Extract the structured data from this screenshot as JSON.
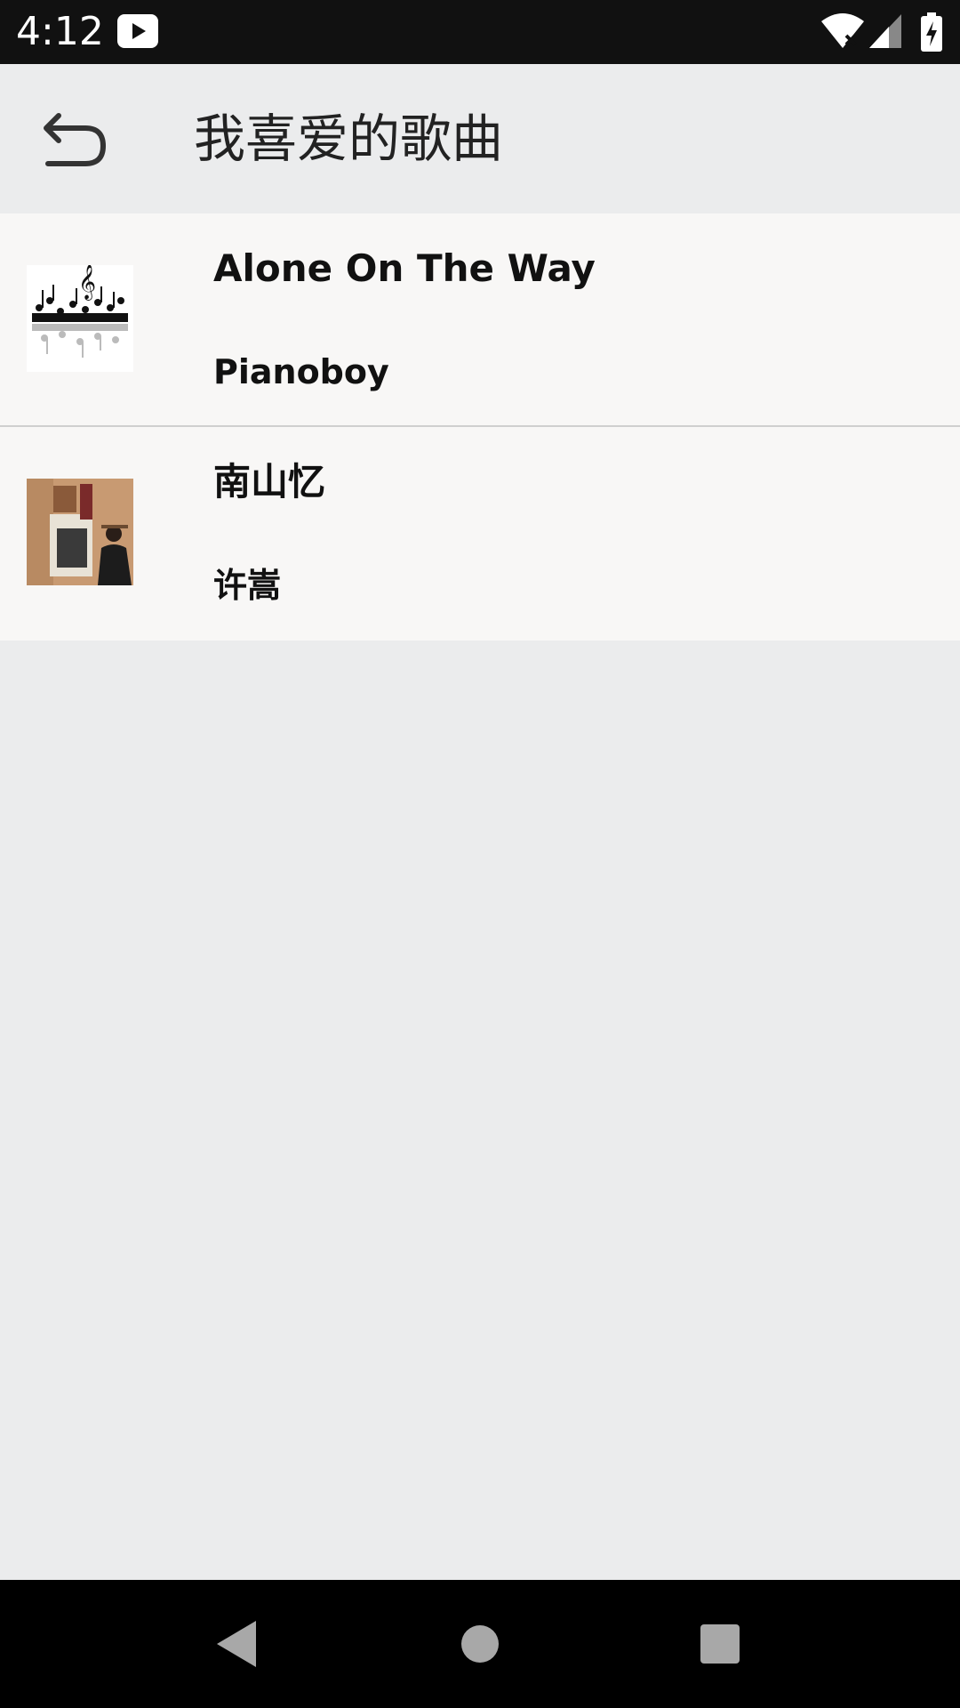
{
  "status_bar": {
    "time": "4:12",
    "icons": [
      "youtube-icon",
      "wifi-icon",
      "signal-icon",
      "battery-charging-icon"
    ]
  },
  "app_bar": {
    "title": "我喜爱的歌曲",
    "back_icon": "undo-arrow-icon"
  },
  "songs": [
    {
      "title": "Alone On The Way",
      "artist": "Pianoboy",
      "cover": "music-notes-cover"
    },
    {
      "title": "南山忆",
      "artist": "许嵩",
      "cover": "album-cover-photo"
    }
  ],
  "nav_bar": {
    "icons": [
      "back-triangle-icon",
      "home-circle-icon",
      "recents-square-icon"
    ]
  },
  "colors": {
    "background": "#ebeced",
    "list_item_bg": "#f8f7f6",
    "status_bar": "#111111",
    "nav_bar": "#000000",
    "divider": "#cfcfcf"
  }
}
